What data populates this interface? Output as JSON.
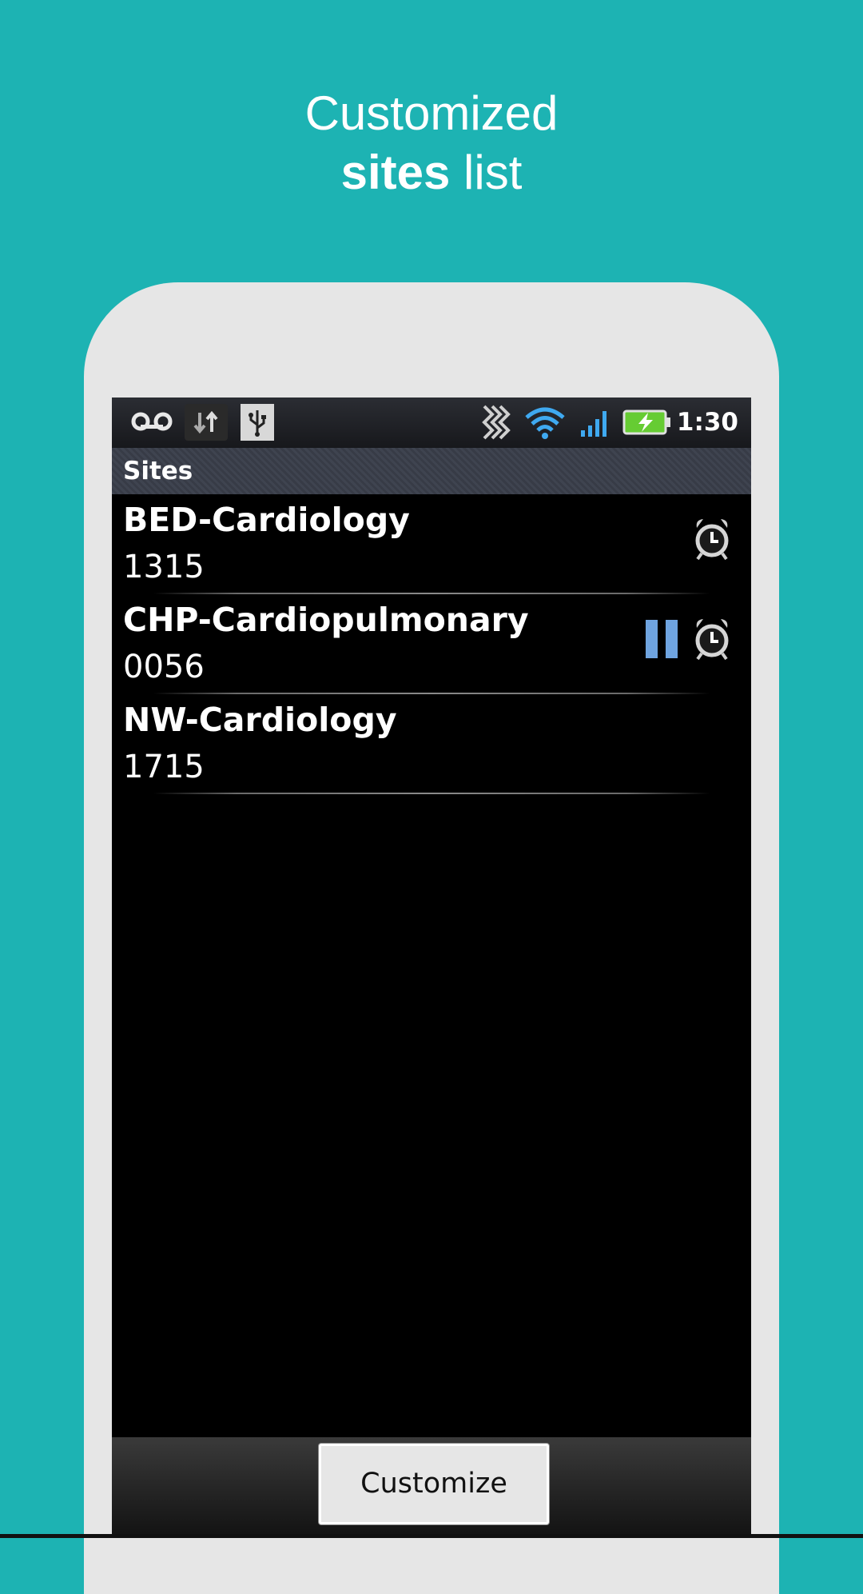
{
  "headline": {
    "line1": "Customized",
    "line2_bold": "sites",
    "line2_rest": " list"
  },
  "status_bar": {
    "icons": [
      "voicemail-icon",
      "data-sync-icon",
      "usb-icon",
      "vibrate-icon",
      "wifi-icon",
      "signal-icon",
      "battery-charging-icon"
    ],
    "time": "1:30"
  },
  "app": {
    "title": "Sites",
    "sites": [
      {
        "name": "BED-Cardiology",
        "code": "1315",
        "icons": [
          "alarm-clock-icon"
        ]
      },
      {
        "name": "CHP-Cardiopulmonary",
        "code": "0056",
        "icons": [
          "pause-icon",
          "alarm-clock-icon"
        ]
      },
      {
        "name": "NW-Cardiology",
        "code": "1715",
        "icons": []
      }
    ],
    "customize_label": "Customize"
  },
  "colors": {
    "background": "#1db3b3",
    "phone": "#e6e6e6",
    "screen": "#000000",
    "pause": "#6fa4e0"
  }
}
